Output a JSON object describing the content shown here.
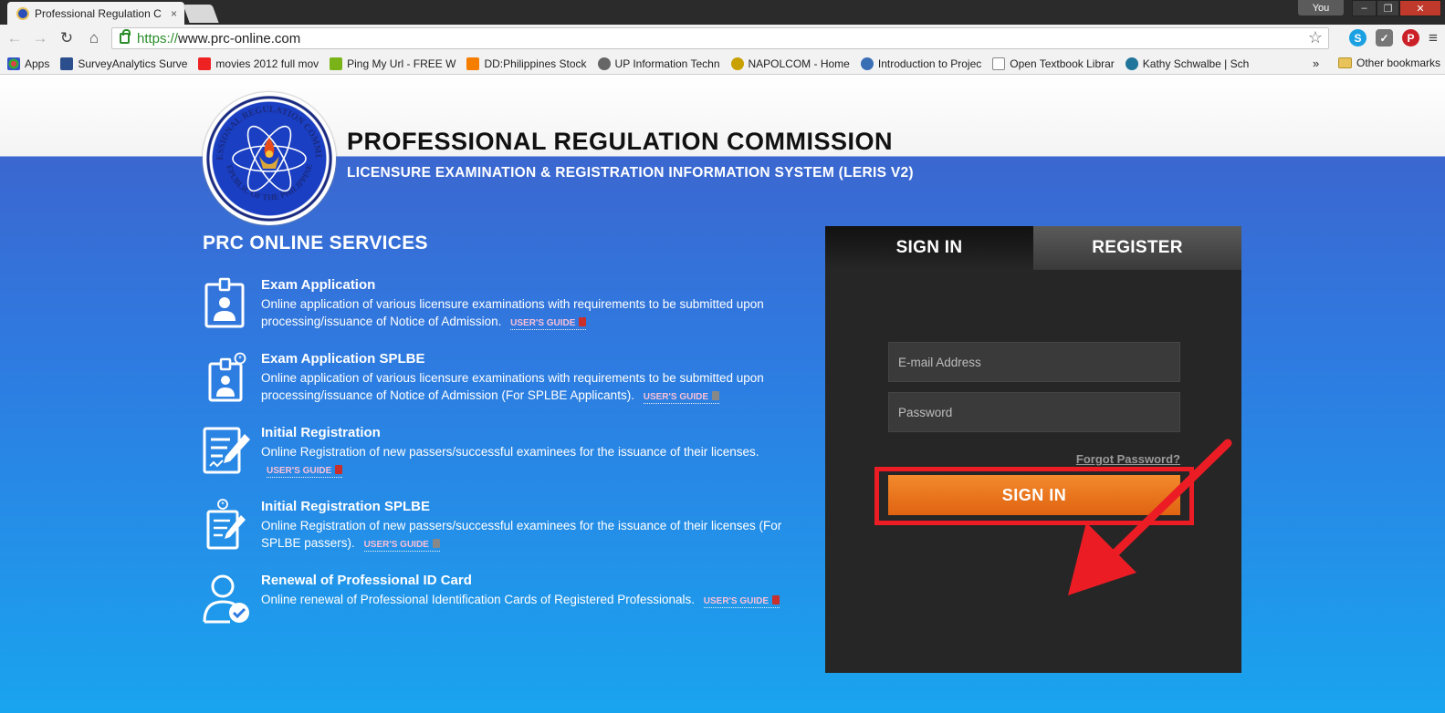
{
  "browser": {
    "tab_title": "Professional Regulation C",
    "tab_close": "×",
    "profile_label": "You",
    "url_scheme": "https://",
    "url_host": "www.prc-online.com",
    "bookmarks": [
      {
        "label": "Apps",
        "color": "#d44"
      },
      {
        "label": "SurveyAnalytics Surve",
        "color": "#2b4e8c"
      },
      {
        "label": "movies 2012 full mov",
        "color": "#e22"
      },
      {
        "label": "Ping My Url - FREE W",
        "color": "#7ab317"
      },
      {
        "label": "DD:Philippines Stock",
        "color": "#f57d00"
      },
      {
        "label": "UP Information Techn",
        "color": "#666"
      },
      {
        "label": "NAPOLCOM - Home",
        "color": "#c8a000"
      },
      {
        "label": "Introduction to Projec",
        "color": "#3a6fb5"
      },
      {
        "label": "Open Textbook Librar",
        "color": "#888"
      },
      {
        "label": "Kathy Schwalbe | Sch",
        "color": "#21759b"
      }
    ],
    "bookmarks_overflow": "»",
    "other_bookmarks": "Other bookmarks"
  },
  "site": {
    "title": "PROFESSIONAL REGULATION COMMISSION",
    "subtitle": "LICENSURE EXAMINATION & REGISTRATION INFORMATION SYSTEM (LERIS V2)",
    "logo_text_top": "PROFESSIONAL REGULATION COMMISSION",
    "logo_text_bottom": "REPUBLIC OF THE PHILIPPINES"
  },
  "services": {
    "heading": "PRC ONLINE SERVICES",
    "guide_label": "USER'S GUIDE",
    "items": [
      {
        "title": "Exam Application",
        "description": "Online application of various licensure examinations with requirements to be submitted upon processing/issuance of Notice of Admission.",
        "guide_color": "#c9302c"
      },
      {
        "title": "Exam Application SPLBE",
        "description": "Online application of various licensure examinations with requirements to be submitted upon processing/issuance of Notice of Admission (For SPLBE Applicants).",
        "guide_color": "#888888"
      },
      {
        "title": "Initial Registration",
        "description": "Online Registration of new passers/successful examinees for the issuance of their licenses.",
        "guide_color": "#c9302c"
      },
      {
        "title": "Initial Registration SPLBE",
        "description": "Online Registration of new passers/successful examinees for the issuance of their licenses (For SPLBE passers).",
        "guide_color": "#888888"
      },
      {
        "title": "Renewal of Professional ID Card",
        "description": "Online renewal of Professional Identification Cards of Registered Professionals.",
        "guide_color": "#c9302c"
      }
    ]
  },
  "auth": {
    "tab_signin": "SIGN IN",
    "tab_register": "REGISTER",
    "email_placeholder": "E-mail Address",
    "password_placeholder": "Password",
    "forgot_password": "Forgot Password?",
    "signin_button": "SIGN IN"
  },
  "colors": {
    "accent_orange": "#e8711c",
    "highlight_red": "#ec1c24",
    "page_blue": "#2f7ae0"
  }
}
